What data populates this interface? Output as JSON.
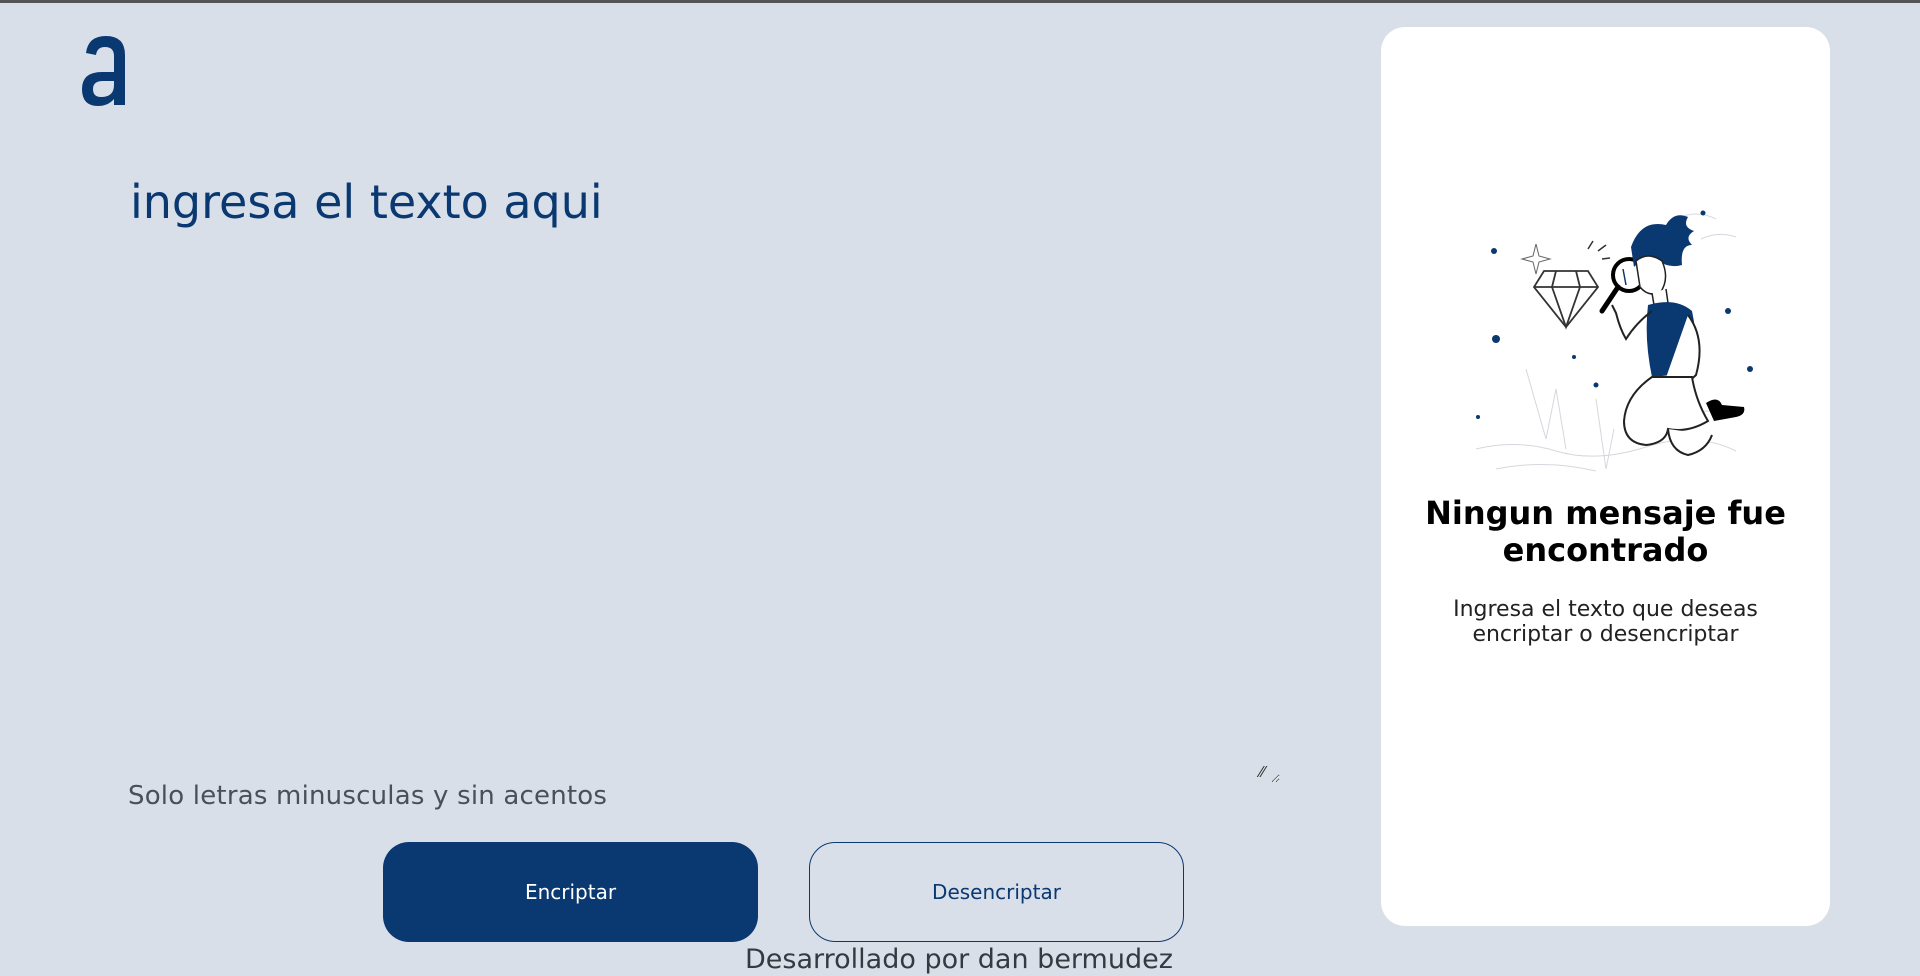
{
  "header": {
    "logo_icon": "letter-a-logo-icon",
    "brand_color": "#0a3871"
  },
  "input": {
    "placeholder": "ingresa el texto aqui",
    "value": ""
  },
  "hint": {
    "text": "Solo letras minusculas y sin acentos",
    "icon": "info-icon"
  },
  "buttons": {
    "encrypt_label": "Encriptar",
    "decrypt_label": "Desencriptar"
  },
  "output": {
    "illustration": "person-with-magnifying-glass-illustration",
    "title": "Ningun mensaje fue encontrado",
    "text": "Ingresa el texto que deseas encriptar o desencriptar"
  },
  "footer": {
    "text": "Desarrollado por dan bermudez"
  },
  "colors": {
    "background": "#d9dfe9",
    "primary": "#0a3871",
    "panel": "#ffffff"
  }
}
